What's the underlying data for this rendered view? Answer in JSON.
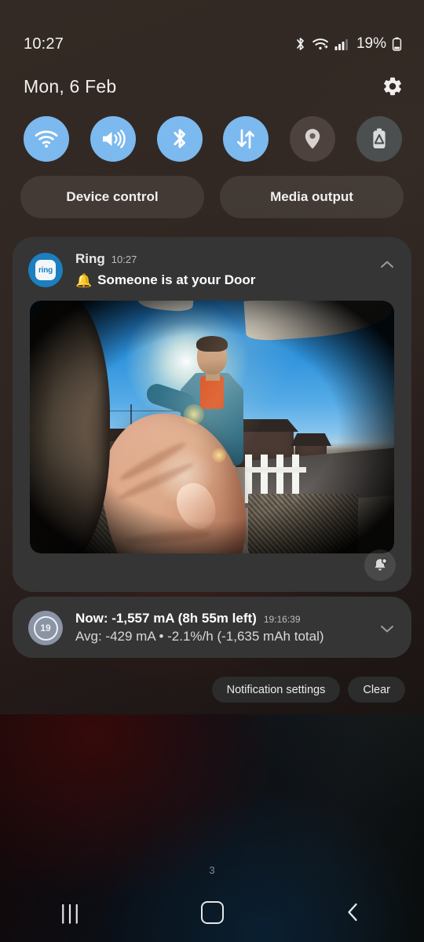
{
  "status_bar": {
    "clock": "10:27",
    "battery_percent": "19%",
    "icons": [
      "bluetooth-icon",
      "wifi-icon",
      "cellular-signal-icon",
      "battery-icon"
    ]
  },
  "shade_header": {
    "date": "Mon, 6 Feb",
    "settings_icon": "gear-icon"
  },
  "quick_settings": {
    "tiles": [
      {
        "name": "wifi",
        "label": "Wi-Fi",
        "icon": "wifi-icon",
        "state": "on"
      },
      {
        "name": "sound",
        "label": "Sound",
        "icon": "volume-icon",
        "state": "on"
      },
      {
        "name": "bluetooth",
        "label": "Bluetooth",
        "icon": "bluetooth-icon",
        "state": "on"
      },
      {
        "name": "mobile-data",
        "label": "Mobile data",
        "icon": "data-transfer-icon",
        "state": "on"
      },
      {
        "name": "location",
        "label": "Location",
        "icon": "location-pin-icon",
        "state": "off"
      },
      {
        "name": "power-saving",
        "label": "Power saving",
        "icon": "battery-saver-icon",
        "state": "off"
      }
    ],
    "accent_on_color": "#7cb9ee",
    "off_color": "#4d423d"
  },
  "shortcut_buttons": {
    "device_control": "Device control",
    "media_output": "Media output"
  },
  "notifications": [
    {
      "id": "ring",
      "app_name": "Ring",
      "time": "10:27",
      "icon": "ring-app-icon",
      "icon_label": "ring",
      "icon_color": "#1b7fc0",
      "title_emoji": "🔔",
      "title": "Someone is at your Door",
      "expand_state": "expanded",
      "chevron_icon": "chevron-up-icon",
      "image_alt": "Ring doorbell camera snapshot: person at the front door with a finger partially covering the lens",
      "action_icon": "bell-badge-icon"
    },
    {
      "id": "battery-monitor",
      "icon": "battery-level-icon",
      "icon_label": "19",
      "icon_color": "#8b94a5",
      "title": "Now: -1,557 mA (8h 55m left)",
      "timestamp": "19:16:39",
      "body": "Avg: -429 mA • -2.1%/h (-1,635 mAh total)",
      "expand_state": "collapsed",
      "chevron_icon": "chevron-down-icon"
    }
  ],
  "footer": {
    "notification_settings": "Notification settings",
    "clear": "Clear"
  },
  "home_screen": {
    "page_indicator": "3"
  },
  "nav_bar": {
    "recents": {
      "label": "Recents",
      "icon": "recents-icon"
    },
    "home": {
      "label": "Home",
      "icon": "home-icon"
    },
    "back": {
      "label": "Back",
      "icon": "back-chevron-icon"
    }
  }
}
